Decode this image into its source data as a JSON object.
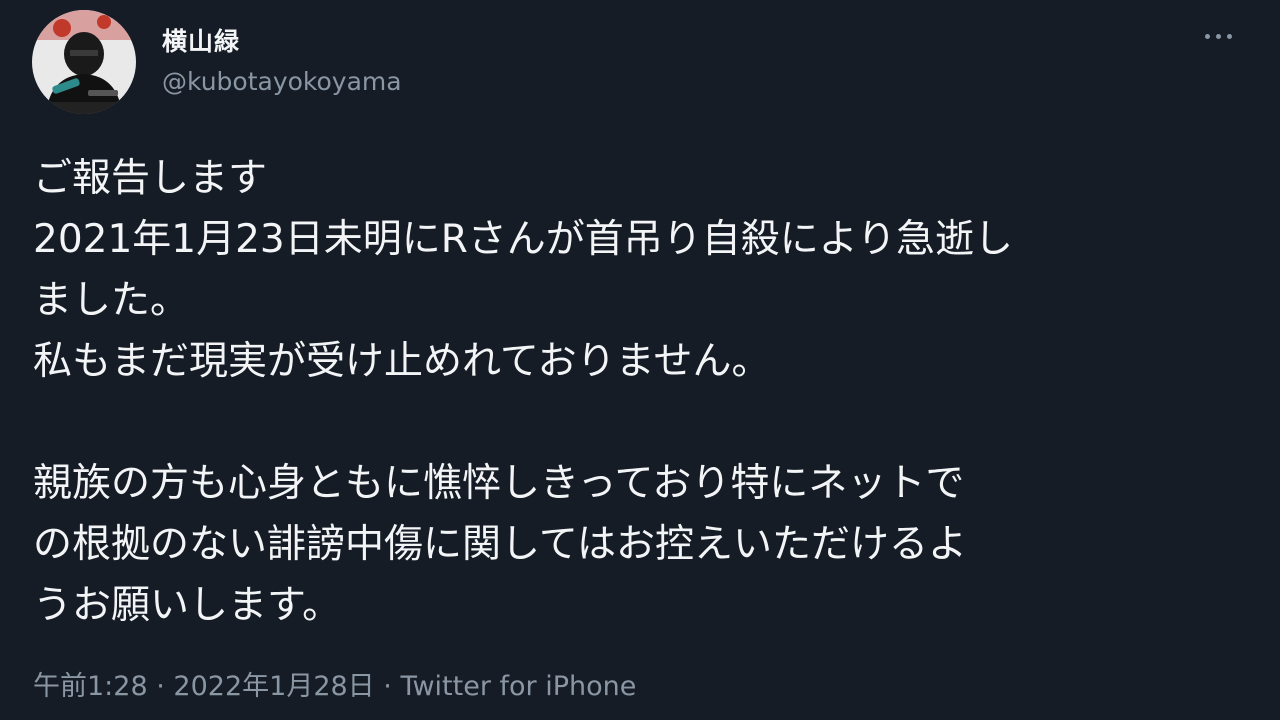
{
  "author": {
    "display_name": "横山緑",
    "handle": "@kubotayokoyama",
    "avatar_icon": "avatar-image"
  },
  "more_icon": "more-horizontal-icon",
  "tweet": {
    "paragraph1": [
      "ご報告します",
      "2021年1月23日未明にRさんが首吊り自殺により急逝し",
      "ました。",
      "私もまだ現実が受け止めれておりません。"
    ],
    "paragraph2": [
      "親族の方も心身ともに憔悴しきっており特にネットで",
      "の根拠のない誹謗中傷に関してはお控えいただけるよ",
      "うお願いします。"
    ]
  },
  "meta": {
    "time": "午前1:28",
    "separator": "·",
    "date": "2022年1月28日",
    "source": "Twitter for iPhone"
  },
  "colors": {
    "background": "#151c26",
    "text": "#f2f4f6",
    "secondary_text": "#8a96a3"
  }
}
